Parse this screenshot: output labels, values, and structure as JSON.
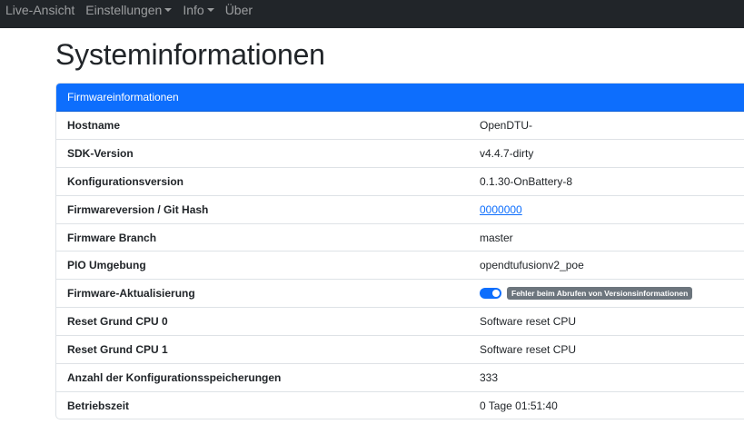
{
  "navbar": {
    "items": [
      {
        "label": "Live-Ansicht",
        "dropdown": false
      },
      {
        "label": "Einstellungen",
        "dropdown": true
      },
      {
        "label": "Info",
        "dropdown": true
      },
      {
        "label": "Über",
        "dropdown": false
      }
    ]
  },
  "page": {
    "title": "Systeminformationen"
  },
  "card": {
    "header": "Firmwareinformationen",
    "rows": [
      {
        "label": "Hostname",
        "value": "OpenDTU-"
      },
      {
        "label": "SDK-Version",
        "value": "v4.4.7-dirty"
      },
      {
        "label": "Konfigurationsversion",
        "value": "0.1.30-OnBattery-8"
      },
      {
        "label": "Firmwareversion / Git Hash",
        "value": "0000000"
      },
      {
        "label": "Firmware Branch",
        "value": "master"
      },
      {
        "label": "PIO Umgebung",
        "value": "opendtufusionv2_poe"
      },
      {
        "label": "Firmware-Aktualisierung",
        "toggle_on": true,
        "badge": "Fehler beim Abrufen von Versionsinformationen"
      },
      {
        "label": "Reset Grund CPU 0",
        "value": "Software reset CPU"
      },
      {
        "label": "Reset Grund CPU 1",
        "value": "Software reset CPU"
      },
      {
        "label": "Anzahl der Konfigurationsspeicherungen",
        "value": "333"
      },
      {
        "label": "Betriebszeit",
        "value": "0 Tage 01:51:40"
      }
    ]
  },
  "colors": {
    "navbar_bg": "#212529",
    "accent": "#0d6efd",
    "badge_bg": "#6c757d"
  }
}
